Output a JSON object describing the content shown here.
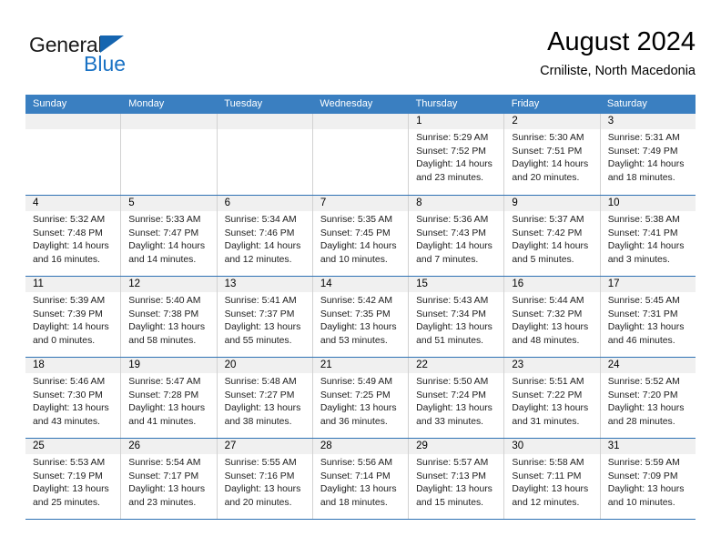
{
  "logo": {
    "word_one": "General",
    "word_two": "Blue",
    "triangle_color": "#1565b0",
    "blue_color": "#1a72c4"
  },
  "header": {
    "title": "August 2024",
    "subtitle": "Crniliste, North Macedonia"
  },
  "theme": {
    "header_row_bg": "#3a7fc1",
    "week_divider": "#2f72b4",
    "daynum_bg": "#f0f0f0",
    "cell_border": "#d2d2d2"
  },
  "weekdays": [
    "Sunday",
    "Monday",
    "Tuesday",
    "Wednesday",
    "Thursday",
    "Friday",
    "Saturday"
  ],
  "weeks": [
    [
      {
        "day": "",
        "lines": []
      },
      {
        "day": "",
        "lines": []
      },
      {
        "day": "",
        "lines": []
      },
      {
        "day": "",
        "lines": []
      },
      {
        "day": "1",
        "lines": [
          "Sunrise: 5:29 AM",
          "Sunset: 7:52 PM",
          "Daylight: 14 hours",
          "and 23 minutes."
        ]
      },
      {
        "day": "2",
        "lines": [
          "Sunrise: 5:30 AM",
          "Sunset: 7:51 PM",
          "Daylight: 14 hours",
          "and 20 minutes."
        ]
      },
      {
        "day": "3",
        "lines": [
          "Sunrise: 5:31 AM",
          "Sunset: 7:49 PM",
          "Daylight: 14 hours",
          "and 18 minutes."
        ]
      }
    ],
    [
      {
        "day": "4",
        "lines": [
          "Sunrise: 5:32 AM",
          "Sunset: 7:48 PM",
          "Daylight: 14 hours",
          "and 16 minutes."
        ]
      },
      {
        "day": "5",
        "lines": [
          "Sunrise: 5:33 AM",
          "Sunset: 7:47 PM",
          "Daylight: 14 hours",
          "and 14 minutes."
        ]
      },
      {
        "day": "6",
        "lines": [
          "Sunrise: 5:34 AM",
          "Sunset: 7:46 PM",
          "Daylight: 14 hours",
          "and 12 minutes."
        ]
      },
      {
        "day": "7",
        "lines": [
          "Sunrise: 5:35 AM",
          "Sunset: 7:45 PM",
          "Daylight: 14 hours",
          "and 10 minutes."
        ]
      },
      {
        "day": "8",
        "lines": [
          "Sunrise: 5:36 AM",
          "Sunset: 7:43 PM",
          "Daylight: 14 hours",
          "and 7 minutes."
        ]
      },
      {
        "day": "9",
        "lines": [
          "Sunrise: 5:37 AM",
          "Sunset: 7:42 PM",
          "Daylight: 14 hours",
          "and 5 minutes."
        ]
      },
      {
        "day": "10",
        "lines": [
          "Sunrise: 5:38 AM",
          "Sunset: 7:41 PM",
          "Daylight: 14 hours",
          "and 3 minutes."
        ]
      }
    ],
    [
      {
        "day": "11",
        "lines": [
          "Sunrise: 5:39 AM",
          "Sunset: 7:39 PM",
          "Daylight: 14 hours",
          "and 0 minutes."
        ]
      },
      {
        "day": "12",
        "lines": [
          "Sunrise: 5:40 AM",
          "Sunset: 7:38 PM",
          "Daylight: 13 hours",
          "and 58 minutes."
        ]
      },
      {
        "day": "13",
        "lines": [
          "Sunrise: 5:41 AM",
          "Sunset: 7:37 PM",
          "Daylight: 13 hours",
          "and 55 minutes."
        ]
      },
      {
        "day": "14",
        "lines": [
          "Sunrise: 5:42 AM",
          "Sunset: 7:35 PM",
          "Daylight: 13 hours",
          "and 53 minutes."
        ]
      },
      {
        "day": "15",
        "lines": [
          "Sunrise: 5:43 AM",
          "Sunset: 7:34 PM",
          "Daylight: 13 hours",
          "and 51 minutes."
        ]
      },
      {
        "day": "16",
        "lines": [
          "Sunrise: 5:44 AM",
          "Sunset: 7:32 PM",
          "Daylight: 13 hours",
          "and 48 minutes."
        ]
      },
      {
        "day": "17",
        "lines": [
          "Sunrise: 5:45 AM",
          "Sunset: 7:31 PM",
          "Daylight: 13 hours",
          "and 46 minutes."
        ]
      }
    ],
    [
      {
        "day": "18",
        "lines": [
          "Sunrise: 5:46 AM",
          "Sunset: 7:30 PM",
          "Daylight: 13 hours",
          "and 43 minutes."
        ]
      },
      {
        "day": "19",
        "lines": [
          "Sunrise: 5:47 AM",
          "Sunset: 7:28 PM",
          "Daylight: 13 hours",
          "and 41 minutes."
        ]
      },
      {
        "day": "20",
        "lines": [
          "Sunrise: 5:48 AM",
          "Sunset: 7:27 PM",
          "Daylight: 13 hours",
          "and 38 minutes."
        ]
      },
      {
        "day": "21",
        "lines": [
          "Sunrise: 5:49 AM",
          "Sunset: 7:25 PM",
          "Daylight: 13 hours",
          "and 36 minutes."
        ]
      },
      {
        "day": "22",
        "lines": [
          "Sunrise: 5:50 AM",
          "Sunset: 7:24 PM",
          "Daylight: 13 hours",
          "and 33 minutes."
        ]
      },
      {
        "day": "23",
        "lines": [
          "Sunrise: 5:51 AM",
          "Sunset: 7:22 PM",
          "Daylight: 13 hours",
          "and 31 minutes."
        ]
      },
      {
        "day": "24",
        "lines": [
          "Sunrise: 5:52 AM",
          "Sunset: 7:20 PM",
          "Daylight: 13 hours",
          "and 28 minutes."
        ]
      }
    ],
    [
      {
        "day": "25",
        "lines": [
          "Sunrise: 5:53 AM",
          "Sunset: 7:19 PM",
          "Daylight: 13 hours",
          "and 25 minutes."
        ]
      },
      {
        "day": "26",
        "lines": [
          "Sunrise: 5:54 AM",
          "Sunset: 7:17 PM",
          "Daylight: 13 hours",
          "and 23 minutes."
        ]
      },
      {
        "day": "27",
        "lines": [
          "Sunrise: 5:55 AM",
          "Sunset: 7:16 PM",
          "Daylight: 13 hours",
          "and 20 minutes."
        ]
      },
      {
        "day": "28",
        "lines": [
          "Sunrise: 5:56 AM",
          "Sunset: 7:14 PM",
          "Daylight: 13 hours",
          "and 18 minutes."
        ]
      },
      {
        "day": "29",
        "lines": [
          "Sunrise: 5:57 AM",
          "Sunset: 7:13 PM",
          "Daylight: 13 hours",
          "and 15 minutes."
        ]
      },
      {
        "day": "30",
        "lines": [
          "Sunrise: 5:58 AM",
          "Sunset: 7:11 PM",
          "Daylight: 13 hours",
          "and 12 minutes."
        ]
      },
      {
        "day": "31",
        "lines": [
          "Sunrise: 5:59 AM",
          "Sunset: 7:09 PM",
          "Daylight: 13 hours",
          "and 10 minutes."
        ]
      }
    ]
  ]
}
